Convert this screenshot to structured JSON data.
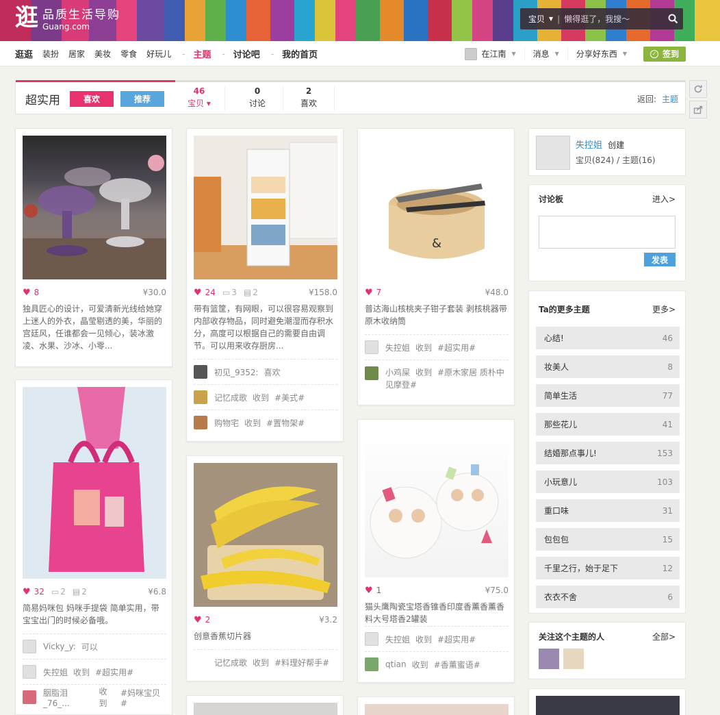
{
  "header": {
    "logo_mark": "逛",
    "slogan": "品质生活导购",
    "domain": "Guang.com",
    "search": {
      "category": "宝贝",
      "placeholder": "懒得逛了，我搜～"
    }
  },
  "nav": {
    "home": "逛逛",
    "items": [
      "装扮",
      "居家",
      "美妆",
      "零食",
      "好玩儿"
    ],
    "dash1": "-",
    "topic": "主题",
    "dash2": "-",
    "discuss": "讨论吧",
    "dash3": "-",
    "myhome": "我的首页",
    "user": "在江南",
    "messages": "消息",
    "share": "分享好东西",
    "checkin": "签到"
  },
  "topic_header": {
    "title": "超实用",
    "like_btn": "喜欢",
    "recommend_btn": "推荐",
    "stats": [
      {
        "num": "46",
        "label": "宝贝 ▾"
      },
      {
        "num": "0",
        "label": "讨论"
      },
      {
        "num": "2",
        "label": "喜欢"
      }
    ],
    "back_label": "返回:",
    "back_link": "主题"
  },
  "cards": [
    {
      "likes": "8",
      "price": "¥30.0",
      "desc": "独具匠心的设计，可爱清新光线给她穿上迷人的外衣，晶莹剔透的美，华丽的宫廷风，任谁都会一见倾心，装冰激凌、水果、沙冰、小零..."
    },
    {
      "likes": "32",
      "comments": "2",
      "collects": "2",
      "price": "¥6.8",
      "desc": "简易妈咪包 妈咪手提袋 简单实用，带宝宝出门的时候必备哦。",
      "acts": [
        {
          "user": "Vicky_y:",
          "action": "可以",
          "tag": ""
        },
        {
          "user": "失控姐",
          "action": "收到",
          "tag": "#超实用#"
        },
        {
          "user": "胭脂泪_76_...",
          "action": "收到",
          "tag": "#妈咪宝贝#"
        }
      ]
    },
    {
      "likes": "24",
      "comments": "3",
      "collects": "2",
      "price": "¥158.0",
      "desc": "带有篮筐，有网眼，可以很容易观察到内部收存物品，同时避免潮湿而存积水分，高度可以根据自己的需要自由调节。可以用来收存厨房...",
      "acts": [
        {
          "user": "初见_9352:",
          "action": "喜欢",
          "tag": ""
        },
        {
          "user": "记忆成歌",
          "action": "收到",
          "tag": "#美式#"
        },
        {
          "user": "购物宅",
          "action": "收到",
          "tag": "#置物架#"
        }
      ]
    },
    {
      "likes": "2",
      "price": "¥3.2",
      "desc": "创意香蕉切片器",
      "acts": [
        {
          "user": "记忆成歌",
          "action": "收到",
          "tag": "#料理好帮手#"
        }
      ]
    },
    {
      "likes": "7",
      "price": "¥48.0",
      "desc": "普达海山核桃夹子钳子套装 剥核桃器带原木收纳筒",
      "acts": [
        {
          "user": "失控姐",
          "action": "收到",
          "tag": "#超实用#"
        },
        {
          "user": "小鸡屎",
          "action": "收到",
          "tag": "#原木家居 质朴中见摩登#"
        }
      ]
    },
    {
      "likes": "1",
      "price": "¥75.0",
      "desc": "猫头鹰陶瓷宝塔香锥香印度香薰香薰香料大号塔香2罐装",
      "acts": [
        {
          "user": "失控姐",
          "action": "收到",
          "tag": "#超实用#"
        },
        {
          "user": "qtian",
          "action": "收到",
          "tag": "#香薰蜜语#"
        }
      ]
    }
  ],
  "sidebar": {
    "creator": {
      "name": "失控姐",
      "created": "创建",
      "stats": "宝贝(824) / 主题(16)"
    },
    "board": {
      "title": "讨论板",
      "enter": "进入>",
      "submit": "发表"
    },
    "more_topics": {
      "title": "Ta的更多主题",
      "more": "更多>",
      "items": [
        {
          "name": "心结!",
          "count": "46"
        },
        {
          "name": "妆美人",
          "count": "8"
        },
        {
          "name": "简单生活",
          "count": "77"
        },
        {
          "name": "那些花儿",
          "count": "41"
        },
        {
          "name": "结婚那点事儿!",
          "count": "153"
        },
        {
          "name": "小玩意儿",
          "count": "103"
        },
        {
          "name": "重口味",
          "count": "31"
        },
        {
          "name": "包包包",
          "count": "15"
        },
        {
          "name": "千里之行，始于足下",
          "count": "12"
        },
        {
          "name": "衣衣不舍",
          "count": "6"
        }
      ]
    },
    "followers": {
      "title": "关注这个主题的人",
      "all": "全部>"
    }
  }
}
